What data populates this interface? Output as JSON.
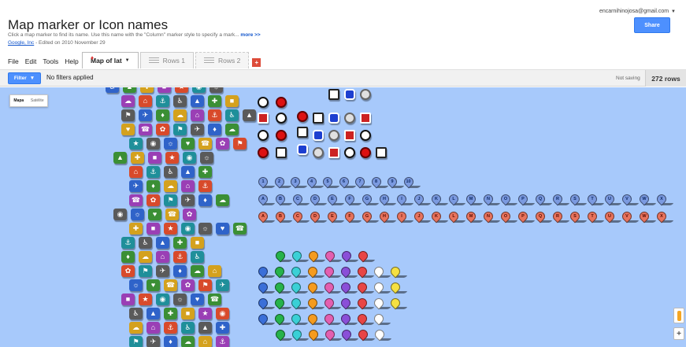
{
  "header": {
    "title": "Map marker or Icon names",
    "description": "Click a map marker to find its name. Use this name with the \"Column\" marker style to specify a mark...",
    "more_link": "more >>",
    "owner": "Google, Inc",
    "edited": "Edited on 2010 November 29",
    "account_email": "encarnihinojosa@gmail.com",
    "share_label": "Share"
  },
  "menu": [
    "File",
    "Edit",
    "Tools",
    "Help"
  ],
  "tabs": [
    {
      "label": "Map of lat",
      "active": true
    },
    {
      "label": "Rows 1",
      "active": false
    },
    {
      "label": "Rows 2",
      "active": false
    }
  ],
  "add_tab_label": "+",
  "filterbar": {
    "filter_label": "Filter",
    "status": "No filters applied",
    "saving": "Not saving",
    "row_count": "272 rows"
  },
  "map": {
    "type_control": {
      "selected": "Mapa",
      "alternate": "Satélite"
    },
    "zoom_in_label": "+",
    "number_pins": [
      "1",
      "2",
      "3",
      "4",
      "5",
      "6",
      "7",
      "8",
      "9",
      "10"
    ],
    "letters": [
      "A",
      "B",
      "C",
      "D",
      "E",
      "F",
      "G",
      "H",
      "I",
      "J",
      "K",
      "L",
      "M",
      "N",
      "O",
      "P",
      "Q",
      "R",
      "S",
      "T",
      "U",
      "V",
      "W",
      "X"
    ],
    "letter_pin_rows": [
      {
        "color": "#7b9ae0",
        "label_color": "#0d2a66"
      },
      {
        "color": "#e8735d",
        "label_color": "#5a0b00"
      }
    ],
    "colored_pin_colors": [
      "#3b6fd8",
      "#26b24b",
      "#3ad0d6",
      "#f59b1e",
      "#e35fb0",
      "#8a4fd8",
      "#e84545",
      "#ffffff",
      "#f5e042"
    ],
    "icon_colors": [
      "#2f63c9",
      "#3b8f35",
      "#d4a11e",
      "#9a3fb5",
      "#d84a2b",
      "#1f8f9a",
      "#5a5a5a"
    ]
  },
  "colors": {
    "accent": "#4d90fe",
    "map_water": "#a7c9fb",
    "add_tab": "#dd4b39"
  }
}
